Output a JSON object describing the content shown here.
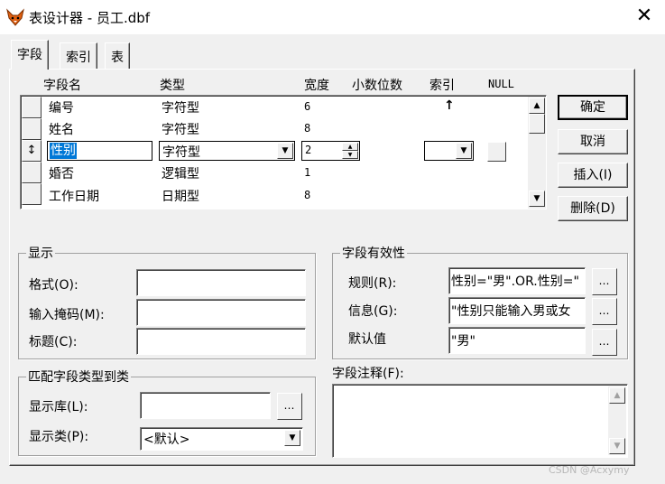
{
  "window": {
    "title": "表设计器 - 员工.dbf",
    "close_glyph": "✕"
  },
  "tabs": [
    {
      "label": "字段"
    },
    {
      "label": "索引"
    },
    {
      "label": "表"
    }
  ],
  "grid": {
    "headers": {
      "name": "字段名",
      "type": "类型",
      "width": "宽度",
      "decimals": "小数位数",
      "index": "索引",
      "null": "NULL"
    },
    "rows": [
      {
        "name": "编号",
        "type": "字符型",
        "width": "6",
        "index": "↑"
      },
      {
        "name": "姓名",
        "type": "字符型",
        "width": "8",
        "index": ""
      },
      {
        "name": "性别",
        "type": "字符型",
        "width": "2",
        "index": ""
      },
      {
        "name": "婚否",
        "type": "逻辑型",
        "width": "1",
        "index": ""
      },
      {
        "name": "工作日期",
        "type": "日期型",
        "width": "8",
        "index": ""
      }
    ],
    "current_row_marker": "↕"
  },
  "buttons": {
    "ok": "确定",
    "cancel": "取消",
    "insert": "插入(I)",
    "delete": "删除(D)"
  },
  "display_group": {
    "title": "显示",
    "format_label": "格式(O):",
    "format_value": "",
    "mask_label": "输入掩码(M):",
    "mask_value": "",
    "caption_label": "标题(C):",
    "caption_value": ""
  },
  "match_group": {
    "title": "匹配字段类型到类",
    "lib_label": "显示库(L):",
    "lib_value": "",
    "class_label": "显示类(P):",
    "class_value": "<默认>"
  },
  "validation_group": {
    "title": "字段有效性",
    "rule_label": "规则(R):",
    "rule_value": "性别=\"男\".OR.性别=\"",
    "message_label": "信息(G):",
    "message_value": "\"性别只能输入男或女",
    "default_label": "默认值",
    "default_value": "\"男\""
  },
  "comment": {
    "label": "字段注释(F):",
    "value": ""
  },
  "watermark": "CSDN @Acxymy"
}
